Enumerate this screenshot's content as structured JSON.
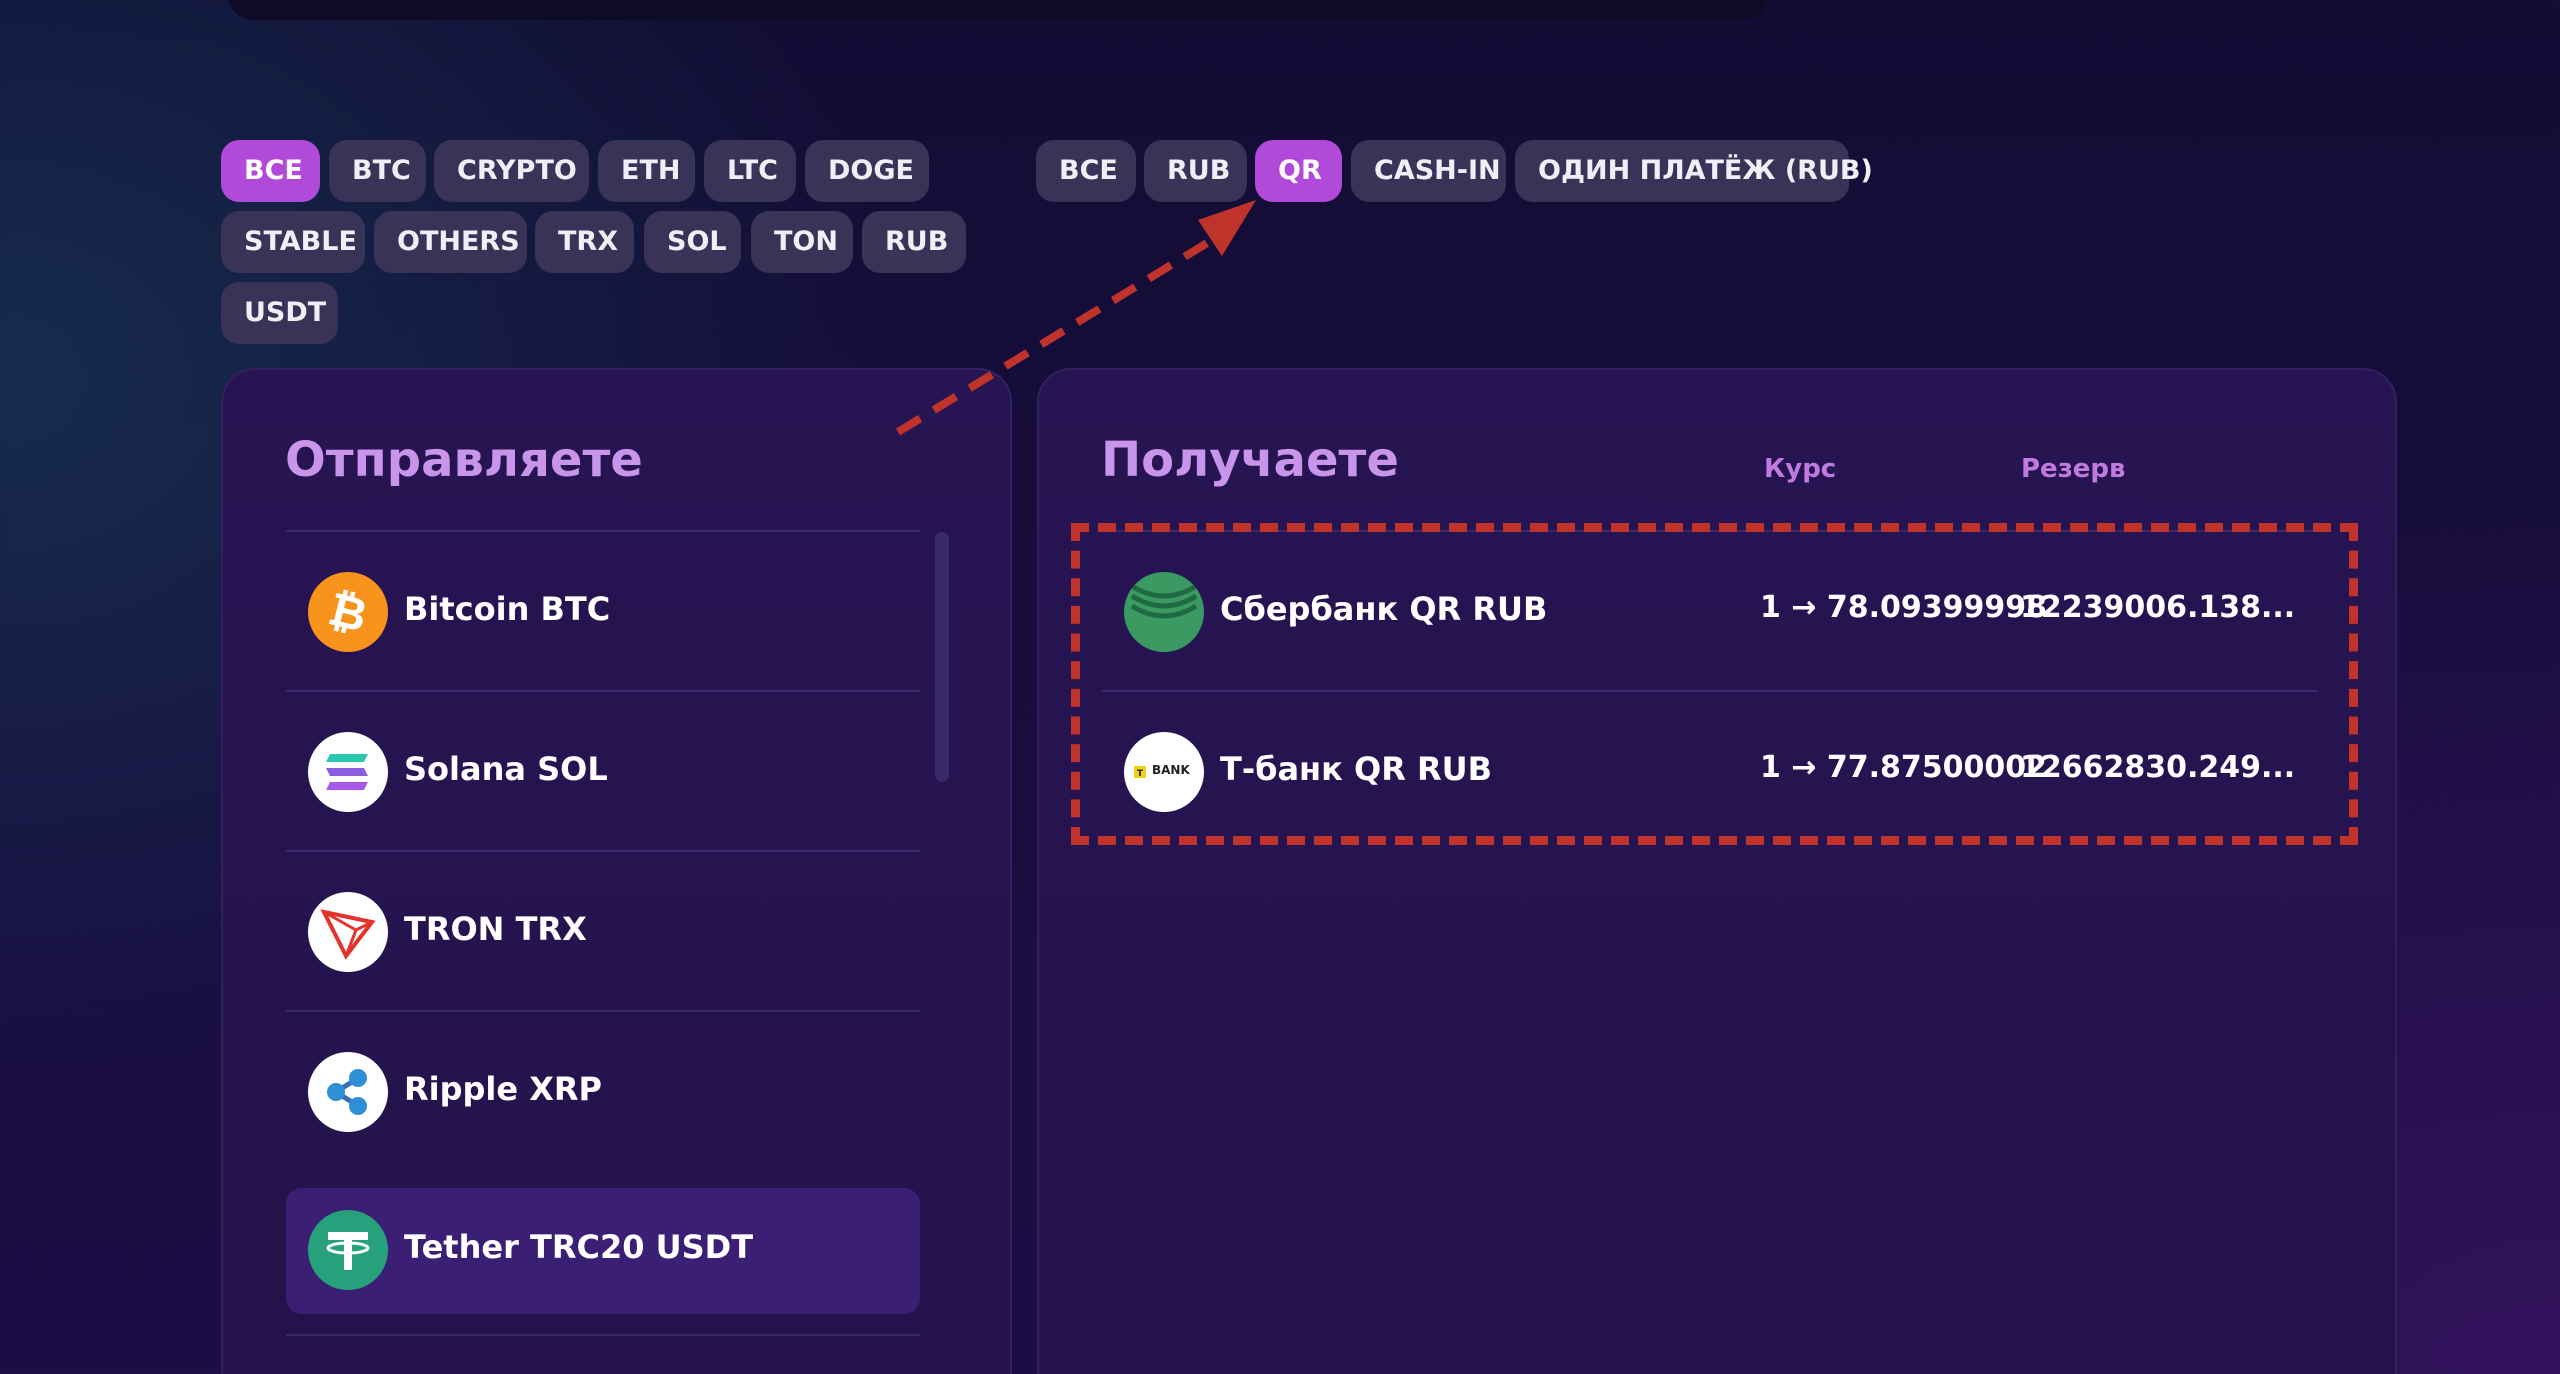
{
  "left_filters": {
    "chips": [
      {
        "label": "ВСЕ",
        "active": true
      },
      {
        "label": "BTC",
        "active": false
      },
      {
        "label": "CRYPTO",
        "active": false
      },
      {
        "label": "ETH",
        "active": false
      },
      {
        "label": "LTC",
        "active": false
      },
      {
        "label": "DOGE",
        "active": false
      },
      {
        "label": "STABLE",
        "active": false
      },
      {
        "label": "OTHERS",
        "active": false
      },
      {
        "label": "TRX",
        "active": false
      },
      {
        "label": "SOL",
        "active": false
      },
      {
        "label": "TON",
        "active": false
      },
      {
        "label": "RUB",
        "active": false
      },
      {
        "label": "USDT",
        "active": false
      }
    ]
  },
  "right_filters": {
    "chips": [
      {
        "label": "ВСЕ",
        "active": false
      },
      {
        "label": "RUB",
        "active": false
      },
      {
        "label": "QR",
        "active": true
      },
      {
        "label": "CASH-IN",
        "active": false
      },
      {
        "label": "ОДИН ПЛАТЁЖ (RUB)",
        "active": false
      }
    ]
  },
  "send_panel": {
    "title": "Отправляете",
    "items": [
      {
        "label": "Bitcoin BTC",
        "icon": "bitcoin-icon",
        "color": "#f7931a",
        "selected": false
      },
      {
        "label": "Solana SOL",
        "icon": "solana-icon",
        "color": "#ffffff",
        "selected": false
      },
      {
        "label": "TRON TRX",
        "icon": "tron-icon",
        "color": "#ffffff",
        "selected": false
      },
      {
        "label": "Ripple XRP",
        "icon": "ripple-icon",
        "color": "#ffffff",
        "selected": false
      },
      {
        "label": "Tether TRC20 USDT",
        "icon": "tether-icon",
        "color": "#26a17b",
        "selected": true
      }
    ]
  },
  "receive_panel": {
    "title": "Получаете",
    "col_rate": "Курс",
    "col_reserve": "Резерв",
    "items": [
      {
        "label": "Сбербанк QR RUB",
        "icon": "sberbank-icon",
        "rate": "1 → 78.09399998",
        "reserve": "12239006.138..."
      },
      {
        "label": "Т-банк QR RUB",
        "icon": "tbank-icon",
        "logo_text": "BANK",
        "rate": "1 → 77.87500002",
        "reserve": "12662830.249..."
      }
    ]
  },
  "annotation": {
    "color": "#c0332a"
  }
}
